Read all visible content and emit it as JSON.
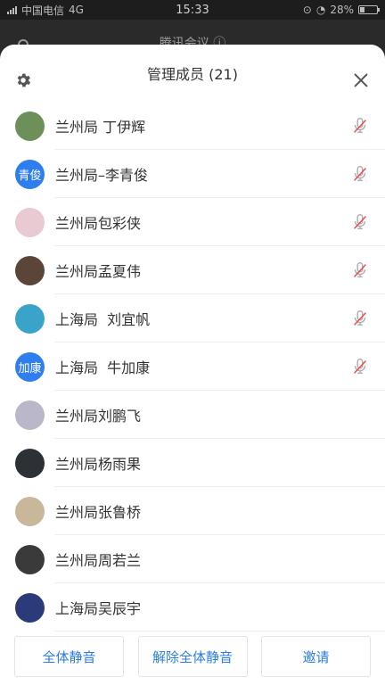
{
  "status_bar": {
    "carrier": "中国电信",
    "network": "4G",
    "time": "15:33",
    "battery": "28%",
    "battery_level": 0.28
  },
  "background_app": {
    "title": "腾讯会议 ⓘ"
  },
  "sheet": {
    "title": "管理成员 (21)",
    "settings_icon": "gear-icon",
    "close_icon": "close-icon"
  },
  "members": [
    {
      "name": "兰州局 丁伊辉",
      "avatar_text": "",
      "avatar_color": "#6d8f5a",
      "muted": true
    },
    {
      "name": "兰州局–李青俊",
      "avatar_text": "青俊",
      "avatar_color": "#2f7ef0",
      "muted": true
    },
    {
      "name": "兰州局包彩侠",
      "avatar_text": "",
      "avatar_color": "#e9c9d2",
      "muted": true
    },
    {
      "name": "兰州局孟夏伟",
      "avatar_text": "",
      "avatar_color": "#5a4538",
      "muted": true
    },
    {
      "name": "上海局  刘宜帆",
      "avatar_text": "",
      "avatar_color": "#3aa3c9",
      "muted": true
    },
    {
      "name": "上海局  牛加康",
      "avatar_text": "加康",
      "avatar_color": "#2f7ef0",
      "muted": true
    },
    {
      "name": "兰州局刘鹏飞",
      "avatar_text": "",
      "avatar_color": "#b9b7c9",
      "muted": false
    },
    {
      "name": "兰州局杨雨果",
      "avatar_text": "",
      "avatar_color": "#2d3034",
      "muted": false
    },
    {
      "name": "兰州局张鲁桥",
      "avatar_text": "",
      "avatar_color": "#c9b79a",
      "muted": false
    },
    {
      "name": "兰州局周若兰",
      "avatar_text": "",
      "avatar_color": "#3a3a3a",
      "muted": false
    },
    {
      "name": "上海局吴辰宇",
      "avatar_text": "",
      "avatar_color": "#2b3a78",
      "muted": false
    }
  ],
  "footer": {
    "mute_all": "全体静音",
    "unmute_all": "解除全体静音",
    "invite": "邀请"
  },
  "colors": {
    "accent": "#2a7de1",
    "muted_mic": "#b0b0b0",
    "muted_slash": "#e84b4b"
  }
}
